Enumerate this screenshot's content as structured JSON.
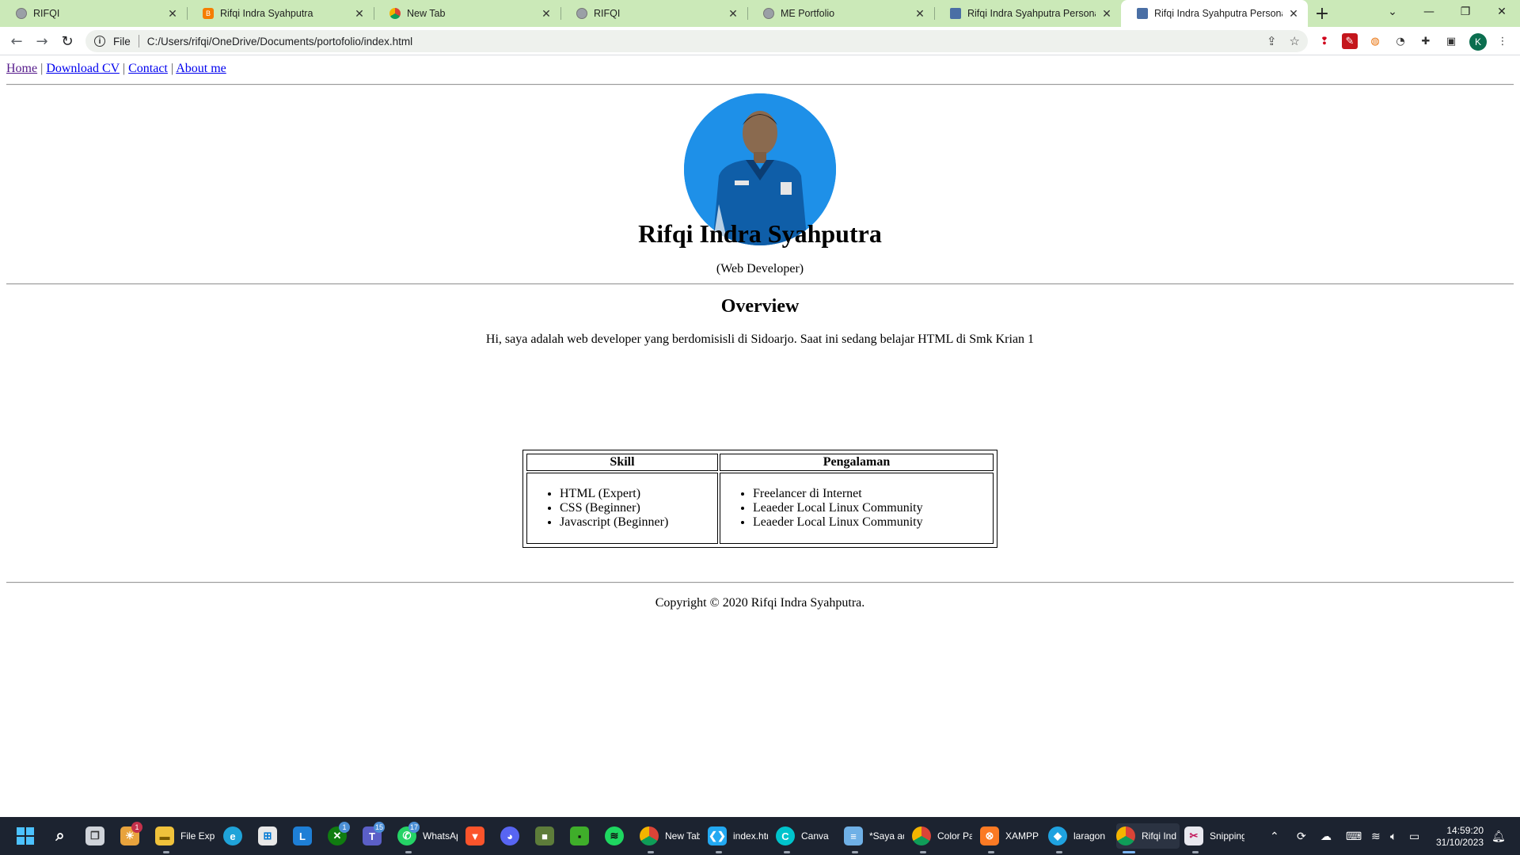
{
  "browser": {
    "tabs": [
      {
        "title": "RIFQI",
        "favicon": "globe-icon",
        "active": false
      },
      {
        "title": "Rifqi Indra Syahputra",
        "favicon": "blogger-icon",
        "active": false
      },
      {
        "title": "New Tab",
        "favicon": "chrome-icon",
        "active": false
      },
      {
        "title": "RIFQI",
        "favicon": "globe-icon",
        "active": false
      },
      {
        "title": "ME Portfolio",
        "favicon": "globe-icon",
        "active": false
      },
      {
        "title": "Rifqi Indra Syahputra Personal W",
        "favicon": "photo-thumbnail-icon",
        "active": false
      },
      {
        "title": "Rifqi Indra Syahputra Personal W",
        "favicon": "photo-thumbnail-icon",
        "active": true
      }
    ],
    "address": {
      "scheme_label": "File",
      "url": "C:/Users/rifqi/OneDrive/Documents/portofolio/index.html"
    },
    "profile_initial": "K"
  },
  "page": {
    "nav": [
      "Home",
      "Download CV",
      "Contact",
      "About me"
    ],
    "nav_separator": "|",
    "name": "Rifqi Indra Syahputra",
    "role": "(Web Developer)",
    "overview_heading": "Overview",
    "overview_text": "Hi, saya adalah web developer yang berdomisisli di Sidoarjo. Saat ini sedang belajar HTML di Smk Krian 1",
    "table": {
      "headers": [
        "Skill",
        "Pengalaman"
      ],
      "skills": [
        "HTML (Expert)",
        "CSS (Beginner)",
        "Javascript (Beginner)"
      ],
      "experience": [
        "Freelancer di Internet",
        "Leaeder Local Linux Community",
        "Leaeder Local Linux Community"
      ]
    },
    "footer": "Copyright © 2020 Rifqi Indra Syahputra."
  },
  "taskbar": {
    "items": [
      {
        "label": "File Expl",
        "icon": "folder-icon"
      },
      {
        "label": "WhatsAp",
        "icon": "whatsapp-icon",
        "badge": "17"
      },
      {
        "label": "New Tab",
        "icon": "chrome-icon"
      },
      {
        "label": "index.htm",
        "icon": "vscode-icon"
      },
      {
        "label": "Canva",
        "icon": "canva-icon"
      },
      {
        "label": "*Saya ad",
        "icon": "notepad-icon"
      },
      {
        "label": "Color Pal",
        "icon": "chrome-icon"
      },
      {
        "label": "XAMPP C",
        "icon": "xampp-icon"
      },
      {
        "label": "laragon",
        "icon": "laragon-icon"
      },
      {
        "label": "Rifqi Indr",
        "icon": "chrome-icon"
      },
      {
        "label": "Snipping",
        "icon": "snipping-tool-icon"
      }
    ],
    "badges": {
      "widgets": "1",
      "xbox": "1",
      "teams": "15",
      "whatsapp": "17"
    },
    "clock": {
      "time": "14:59:20",
      "date": "31/10/2023"
    }
  },
  "colors": {
    "tabstrip": "#cbe9b8",
    "link": "#0000ee",
    "visited_link": "#551a8b",
    "taskbar": "#1c2330",
    "avatar_bg": "#1e90e8"
  }
}
